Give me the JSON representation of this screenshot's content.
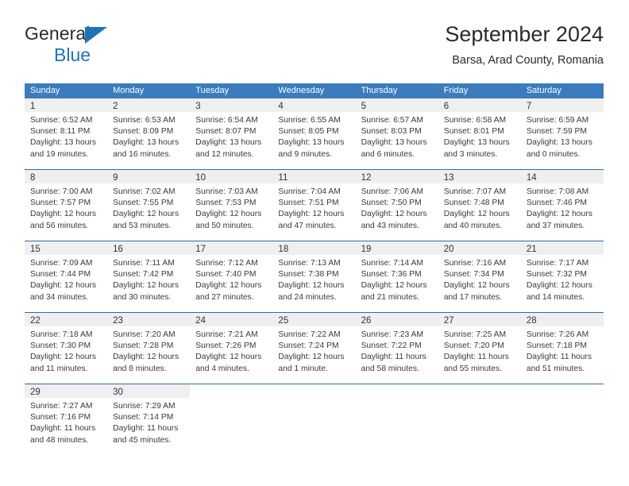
{
  "brand": {
    "line1": "General",
    "line2": "Blue",
    "triangle_color": "#1d74bb",
    "icon": "triangle-logo-icon"
  },
  "header": {
    "title": "September 2024",
    "subtitle": "Barsa, Arad County, Romania"
  },
  "colors": {
    "header_blue": "#3a7cbe",
    "week_rule_blue": "#2e6da4",
    "daynum_band": "#efefef",
    "text": "#3a3a3a"
  },
  "weekdays": [
    "Sunday",
    "Monday",
    "Tuesday",
    "Wednesday",
    "Thursday",
    "Friday",
    "Saturday"
  ],
  "labels": {
    "sunrise_prefix": "Sunrise:",
    "sunset_prefix": "Sunset:",
    "daylight_prefix": "Daylight:"
  },
  "weeks": [
    {
      "days": [
        {
          "date": "1",
          "sunrise": "Sunrise: 6:52 AM",
          "sunset": "Sunset: 8:11 PM",
          "daylight_1": "Daylight: 13 hours",
          "daylight_2": "and 19 minutes."
        },
        {
          "date": "2",
          "sunrise": "Sunrise: 6:53 AM",
          "sunset": "Sunset: 8:09 PM",
          "daylight_1": "Daylight: 13 hours",
          "daylight_2": "and 16 minutes."
        },
        {
          "date": "3",
          "sunrise": "Sunrise: 6:54 AM",
          "sunset": "Sunset: 8:07 PM",
          "daylight_1": "Daylight: 13 hours",
          "daylight_2": "and 12 minutes."
        },
        {
          "date": "4",
          "sunrise": "Sunrise: 6:55 AM",
          "sunset": "Sunset: 8:05 PM",
          "daylight_1": "Daylight: 13 hours",
          "daylight_2": "and 9 minutes."
        },
        {
          "date": "5",
          "sunrise": "Sunrise: 6:57 AM",
          "sunset": "Sunset: 8:03 PM",
          "daylight_1": "Daylight: 13 hours",
          "daylight_2": "and 6 minutes."
        },
        {
          "date": "6",
          "sunrise": "Sunrise: 6:58 AM",
          "sunset": "Sunset: 8:01 PM",
          "daylight_1": "Daylight: 13 hours",
          "daylight_2": "and 3 minutes."
        },
        {
          "date": "7",
          "sunrise": "Sunrise: 6:59 AM",
          "sunset": "Sunset: 7:59 PM",
          "daylight_1": "Daylight: 13 hours",
          "daylight_2": "and 0 minutes."
        }
      ]
    },
    {
      "days": [
        {
          "date": "8",
          "sunrise": "Sunrise: 7:00 AM",
          "sunset": "Sunset: 7:57 PM",
          "daylight_1": "Daylight: 12 hours",
          "daylight_2": "and 56 minutes."
        },
        {
          "date": "9",
          "sunrise": "Sunrise: 7:02 AM",
          "sunset": "Sunset: 7:55 PM",
          "daylight_1": "Daylight: 12 hours",
          "daylight_2": "and 53 minutes."
        },
        {
          "date": "10",
          "sunrise": "Sunrise: 7:03 AM",
          "sunset": "Sunset: 7:53 PM",
          "daylight_1": "Daylight: 12 hours",
          "daylight_2": "and 50 minutes."
        },
        {
          "date": "11",
          "sunrise": "Sunrise: 7:04 AM",
          "sunset": "Sunset: 7:51 PM",
          "daylight_1": "Daylight: 12 hours",
          "daylight_2": "and 47 minutes."
        },
        {
          "date": "12",
          "sunrise": "Sunrise: 7:06 AM",
          "sunset": "Sunset: 7:50 PM",
          "daylight_1": "Daylight: 12 hours",
          "daylight_2": "and 43 minutes."
        },
        {
          "date": "13",
          "sunrise": "Sunrise: 7:07 AM",
          "sunset": "Sunset: 7:48 PM",
          "daylight_1": "Daylight: 12 hours",
          "daylight_2": "and 40 minutes."
        },
        {
          "date": "14",
          "sunrise": "Sunrise: 7:08 AM",
          "sunset": "Sunset: 7:46 PM",
          "daylight_1": "Daylight: 12 hours",
          "daylight_2": "and 37 minutes."
        }
      ]
    },
    {
      "days": [
        {
          "date": "15",
          "sunrise": "Sunrise: 7:09 AM",
          "sunset": "Sunset: 7:44 PM",
          "daylight_1": "Daylight: 12 hours",
          "daylight_2": "and 34 minutes."
        },
        {
          "date": "16",
          "sunrise": "Sunrise: 7:11 AM",
          "sunset": "Sunset: 7:42 PM",
          "daylight_1": "Daylight: 12 hours",
          "daylight_2": "and 30 minutes."
        },
        {
          "date": "17",
          "sunrise": "Sunrise: 7:12 AM",
          "sunset": "Sunset: 7:40 PM",
          "daylight_1": "Daylight: 12 hours",
          "daylight_2": "and 27 minutes."
        },
        {
          "date": "18",
          "sunrise": "Sunrise: 7:13 AM",
          "sunset": "Sunset: 7:38 PM",
          "daylight_1": "Daylight: 12 hours",
          "daylight_2": "and 24 minutes."
        },
        {
          "date": "19",
          "sunrise": "Sunrise: 7:14 AM",
          "sunset": "Sunset: 7:36 PM",
          "daylight_1": "Daylight: 12 hours",
          "daylight_2": "and 21 minutes."
        },
        {
          "date": "20",
          "sunrise": "Sunrise: 7:16 AM",
          "sunset": "Sunset: 7:34 PM",
          "daylight_1": "Daylight: 12 hours",
          "daylight_2": "and 17 minutes."
        },
        {
          "date": "21",
          "sunrise": "Sunrise: 7:17 AM",
          "sunset": "Sunset: 7:32 PM",
          "daylight_1": "Daylight: 12 hours",
          "daylight_2": "and 14 minutes."
        }
      ]
    },
    {
      "days": [
        {
          "date": "22",
          "sunrise": "Sunrise: 7:18 AM",
          "sunset": "Sunset: 7:30 PM",
          "daylight_1": "Daylight: 12 hours",
          "daylight_2": "and 11 minutes."
        },
        {
          "date": "23",
          "sunrise": "Sunrise: 7:20 AM",
          "sunset": "Sunset: 7:28 PM",
          "daylight_1": "Daylight: 12 hours",
          "daylight_2": "and 8 minutes."
        },
        {
          "date": "24",
          "sunrise": "Sunrise: 7:21 AM",
          "sunset": "Sunset: 7:26 PM",
          "daylight_1": "Daylight: 12 hours",
          "daylight_2": "and 4 minutes."
        },
        {
          "date": "25",
          "sunrise": "Sunrise: 7:22 AM",
          "sunset": "Sunset: 7:24 PM",
          "daylight_1": "Daylight: 12 hours",
          "daylight_2": "and 1 minute."
        },
        {
          "date": "26",
          "sunrise": "Sunrise: 7:23 AM",
          "sunset": "Sunset: 7:22 PM",
          "daylight_1": "Daylight: 11 hours",
          "daylight_2": "and 58 minutes."
        },
        {
          "date": "27",
          "sunrise": "Sunrise: 7:25 AM",
          "sunset": "Sunset: 7:20 PM",
          "daylight_1": "Daylight: 11 hours",
          "daylight_2": "and 55 minutes."
        },
        {
          "date": "28",
          "sunrise": "Sunrise: 7:26 AM",
          "sunset": "Sunset: 7:18 PM",
          "daylight_1": "Daylight: 11 hours",
          "daylight_2": "and 51 minutes."
        }
      ]
    },
    {
      "days": [
        {
          "date": "29",
          "sunrise": "Sunrise: 7:27 AM",
          "sunset": "Sunset: 7:16 PM",
          "daylight_1": "Daylight: 11 hours",
          "daylight_2": "and 48 minutes."
        },
        {
          "date": "30",
          "sunrise": "Sunrise: 7:29 AM",
          "sunset": "Sunset: 7:14 PM",
          "daylight_1": "Daylight: 11 hours",
          "daylight_2": "and 45 minutes."
        },
        {
          "date": "",
          "sunrise": "",
          "sunset": "",
          "daylight_1": "",
          "daylight_2": ""
        },
        {
          "date": "",
          "sunrise": "",
          "sunset": "",
          "daylight_1": "",
          "daylight_2": ""
        },
        {
          "date": "",
          "sunrise": "",
          "sunset": "",
          "daylight_1": "",
          "daylight_2": ""
        },
        {
          "date": "",
          "sunrise": "",
          "sunset": "",
          "daylight_1": "",
          "daylight_2": ""
        },
        {
          "date": "",
          "sunrise": "",
          "sunset": "",
          "daylight_1": "",
          "daylight_2": ""
        }
      ]
    }
  ]
}
